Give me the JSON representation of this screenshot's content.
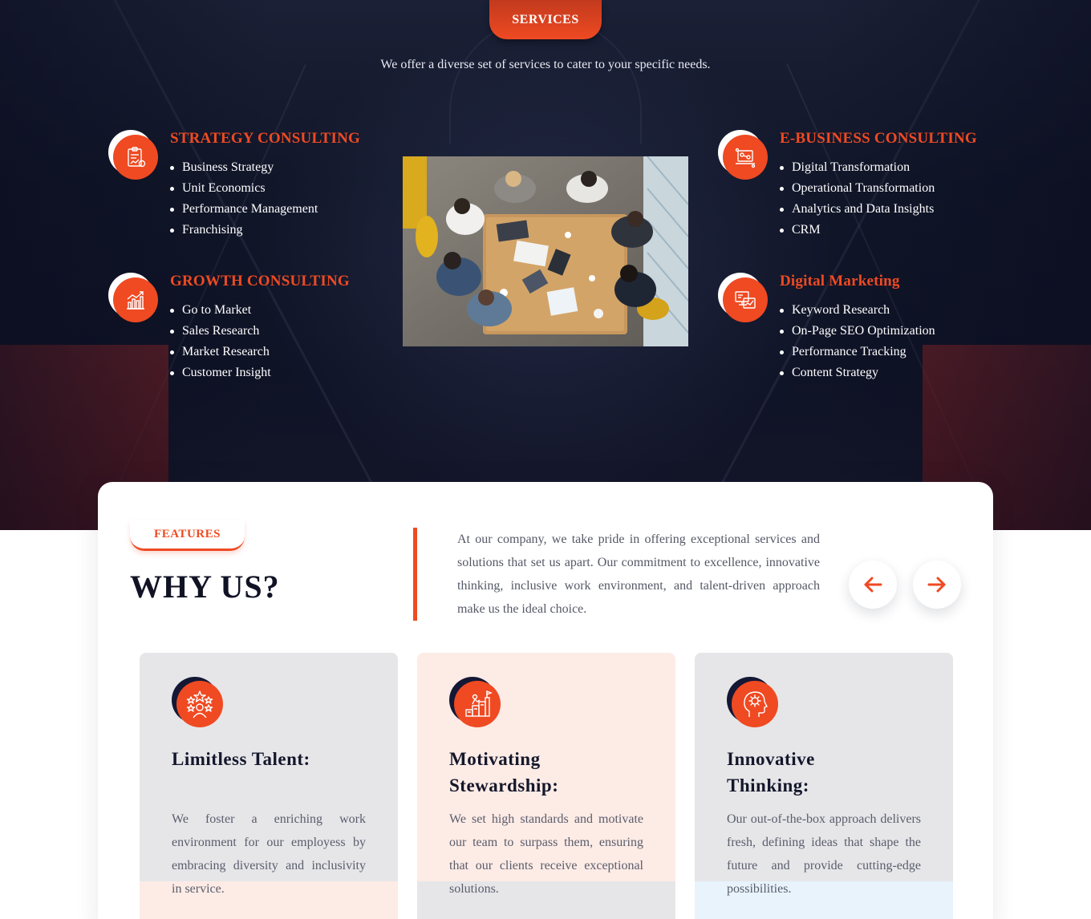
{
  "services": {
    "badge": "SERVICES",
    "subtitle": "We offer a diverse set of services to cater to your specific needs.",
    "items": [
      {
        "title": "STRATEGY CONSULTING",
        "icon": "clipboard-chart-icon",
        "points": [
          "Business Strategy",
          "Unit Economics",
          "Performance Management",
          "Franchising"
        ]
      },
      {
        "title": "GROWTH CONSULTING",
        "icon": "growth-chart-icon",
        "points": [
          "Go to Market",
          "Sales Research",
          "Market Research",
          "Customer Insight"
        ]
      },
      {
        "title": "E-BUSINESS CONSULTING",
        "icon": "laptop-ecommerce-icon",
        "points": [
          "Digital Transformation",
          "Operational Transformation",
          "Analytics and Data Insights",
          "CRM"
        ]
      },
      {
        "title": "Digital Marketing",
        "icon": "monitor-analytics-icon",
        "points": [
          "Keyword Research",
          "On-Page SEO Optimization",
          "Performance Tracking",
          "Content Strategy"
        ]
      }
    ]
  },
  "features": {
    "badge": "FEATURES",
    "heading": "WHY US?",
    "intro": "At our company, we take pride in offering exceptional services and solutions that set us apart. Our commitment to excellence, innovative thinking, inclusive work environment, and talent-driven approach make us the ideal choice.",
    "cards": [
      {
        "title": "Limitless Talent:",
        "icon": "star-person-icon",
        "text": "We foster a enriching work environment for our employess by embracing diversity and inclusivity in service."
      },
      {
        "title": "Motivating Stewardship:",
        "icon": "steps-flag-icon",
        "text": "We set high standards and motivate our team to surpass them, ensuring that our clients receive exceptional solutions."
      },
      {
        "title": "Innovative Thinking:",
        "icon": "head-gear-icon",
        "text": "Our out-of-the-box approach delivers fresh, defining ideas that shape the future and provide cutting-edge possibilities."
      }
    ]
  },
  "colors": {
    "accent": "#ef4a22",
    "dark": "#141834",
    "card_grey": "#e6e6e9",
    "card_peach": "#fdebe6",
    "card_blue": "#e8f3fc"
  }
}
